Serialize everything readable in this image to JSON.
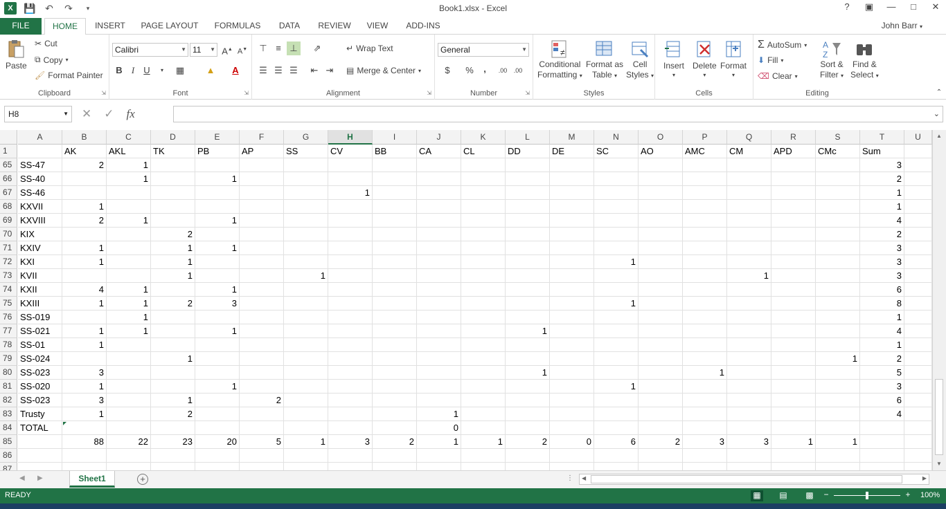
{
  "window": {
    "title": "Book1.xlsx - Excel",
    "user": "John Barr",
    "help": "?",
    "controls": [
      "—",
      "□",
      "✕"
    ]
  },
  "tabs": [
    "FILE",
    "HOME",
    "INSERT",
    "PAGE LAYOUT",
    "FORMULAS",
    "DATA",
    "REVIEW",
    "VIEW",
    "ADD-INS"
  ],
  "ribbon": {
    "clipboard": {
      "label": "Clipboard",
      "paste": "Paste",
      "cut": "Cut",
      "copy": "Copy",
      "format_painter": "Format Painter"
    },
    "font": {
      "label": "Font",
      "name": "Calibri",
      "size": "11",
      "bold": "B",
      "italic": "I",
      "underline": "U",
      "grow": "A",
      "shrink": "A"
    },
    "alignment": {
      "label": "Alignment",
      "wrap": "Wrap Text",
      "merge": "Merge & Center"
    },
    "number": {
      "label": "Number",
      "format": "General",
      "currency": "$",
      "percent": "%",
      "comma": ",",
      "inc_dec": ".00"
    },
    "styles": {
      "label": "Styles",
      "conditional": "Conditional",
      "conditional2": "Formatting",
      "format_as": "Format as",
      "format_as2": "Table",
      "cell": "Cell",
      "cell2": "Styles"
    },
    "cells": {
      "label": "Cells",
      "insert": "Insert",
      "delete": "Delete",
      "format": "Format"
    },
    "editing": {
      "label": "Editing",
      "autosum": "AutoSum",
      "fill": "Fill",
      "clear": "Clear",
      "sort": "Sort &",
      "sort2": "Filter",
      "find": "Find &",
      "find2": "Select"
    }
  },
  "formula_bar": {
    "name_box": "H8",
    "fx": "fx",
    "value": ""
  },
  "sheet": {
    "columns": [
      "A",
      "B",
      "C",
      "D",
      "E",
      "F",
      "G",
      "H",
      "I",
      "J",
      "K",
      "L",
      "M",
      "N",
      "O",
      "P",
      "Q",
      "R",
      "S",
      "T",
      "U"
    ],
    "selected_column": "H",
    "rows": [
      {
        "n": "1",
        "cells": [
          "",
          "AK",
          "AKL",
          "TK",
          "PB",
          "AP",
          "SS",
          "CV",
          "BB",
          "CA",
          "CL",
          "DD",
          "DE",
          "SC",
          "AO",
          "AMC",
          "CM",
          "APD",
          "CMc",
          "Sum",
          ""
        ]
      },
      {
        "n": "65",
        "cells": [
          "SS-47",
          "2",
          "1",
          "",
          "",
          "",
          "",
          "",
          "",
          "",
          "",
          "",
          "",
          "",
          "",
          "",
          "",
          "",
          "",
          "3",
          ""
        ]
      },
      {
        "n": "66",
        "cells": [
          "SS-40",
          "",
          "1",
          "",
          "1",
          "",
          "",
          "",
          "",
          "",
          "",
          "",
          "",
          "",
          "",
          "",
          "",
          "",
          "",
          "2",
          ""
        ]
      },
      {
        "n": "67",
        "cells": [
          "SS-46",
          "",
          "",
          "",
          "",
          "",
          "",
          "1",
          "",
          "",
          "",
          "",
          "",
          "",
          "",
          "",
          "",
          "",
          "",
          "1",
          ""
        ]
      },
      {
        "n": "68",
        "cells": [
          "KXVII",
          "1",
          "",
          "",
          "",
          "",
          "",
          "",
          "",
          "",
          "",
          "",
          "",
          "",
          "",
          "",
          "",
          "",
          "",
          "1",
          ""
        ]
      },
      {
        "n": "69",
        "cells": [
          "KXVIII",
          "2",
          "1",
          "",
          "1",
          "",
          "",
          "",
          "",
          "",
          "",
          "",
          "",
          "",
          "",
          "",
          "",
          "",
          "",
          "4",
          ""
        ]
      },
      {
        "n": "70",
        "cells": [
          "KIX",
          "",
          "",
          "2",
          "",
          "",
          "",
          "",
          "",
          "",
          "",
          "",
          "",
          "",
          "",
          "",
          "",
          "",
          "",
          "2",
          ""
        ]
      },
      {
        "n": "71",
        "cells": [
          "KXIV",
          "1",
          "",
          "1",
          "1",
          "",
          "",
          "",
          "",
          "",
          "",
          "",
          "",
          "",
          "",
          "",
          "",
          "",
          "",
          "3",
          ""
        ]
      },
      {
        "n": "72",
        "cells": [
          "KXI",
          "1",
          "",
          "1",
          "",
          "",
          "",
          "",
          "",
          "",
          "",
          "",
          "",
          "1",
          "",
          "",
          "",
          "",
          "",
          "3",
          ""
        ]
      },
      {
        "n": "73",
        "cells": [
          "KVII",
          "",
          "",
          "1",
          "",
          "",
          "1",
          "",
          "",
          "",
          "",
          "",
          "",
          "",
          "",
          "",
          "1",
          "",
          "",
          "3",
          ""
        ]
      },
      {
        "n": "74",
        "cells": [
          "KXII",
          "4",
          "1",
          "",
          "1",
          "",
          "",
          "",
          "",
          "",
          "",
          "",
          "",
          "",
          "",
          "",
          "",
          "",
          "",
          "6",
          ""
        ]
      },
      {
        "n": "75",
        "cells": [
          "KXIII",
          "1",
          "1",
          "2",
          "3",
          "",
          "",
          "",
          "",
          "",
          "",
          "",
          "",
          "1",
          "",
          "",
          "",
          "",
          "",
          "8",
          ""
        ]
      },
      {
        "n": "76",
        "cells": [
          "SS-019",
          "",
          "1",
          "",
          "",
          "",
          "",
          "",
          "",
          "",
          "",
          "",
          "",
          "",
          "",
          "",
          "",
          "",
          "",
          "1",
          ""
        ]
      },
      {
        "n": "77",
        "cells": [
          "SS-021",
          "1",
          "1",
          "",
          "1",
          "",
          "",
          "",
          "",
          "",
          "",
          "1",
          "",
          "",
          "",
          "",
          "",
          "",
          "",
          "4",
          ""
        ]
      },
      {
        "n": "78",
        "cells": [
          "SS-01",
          "1",
          "",
          "",
          "",
          "",
          "",
          "",
          "",
          "",
          "",
          "",
          "",
          "",
          "",
          "",
          "",
          "",
          "",
          "1",
          ""
        ]
      },
      {
        "n": "79",
        "cells": [
          "SS-024",
          "",
          "",
          "1",
          "",
          "",
          "",
          "",
          "",
          "",
          "",
          "",
          "",
          "",
          "",
          "",
          "",
          "",
          "1",
          "2",
          ""
        ]
      },
      {
        "n": "80",
        "cells": [
          "SS-023",
          "3",
          "",
          "",
          "",
          "",
          "",
          "",
          "",
          "",
          "",
          "1",
          "",
          "",
          "",
          "1",
          "",
          "",
          "",
          "5",
          ""
        ]
      },
      {
        "n": "81",
        "cells": [
          "SS-020",
          "1",
          "",
          "",
          "1",
          "",
          "",
          "",
          "",
          "",
          "",
          "",
          "",
          "1",
          "",
          "",
          "",
          "",
          "",
          "3",
          ""
        ]
      },
      {
        "n": "82",
        "cells": [
          "SS-023",
          "3",
          "",
          "1",
          "",
          "2",
          "",
          "",
          "",
          "",
          "",
          "",
          "",
          "",
          "",
          "",
          "",
          "",
          "",
          "6",
          ""
        ]
      },
      {
        "n": "83",
        "cells": [
          "Trusty",
          "1",
          "",
          "2",
          "",
          "",
          "",
          "",
          "",
          "1",
          "",
          "",
          "",
          "",
          "",
          "",
          "",
          "",
          "",
          "4",
          ""
        ]
      },
      {
        "n": "84",
        "cells": [
          "TOTAL",
          "",
          "",
          "",
          "",
          "",
          "",
          "",
          "",
          "0",
          "",
          "",
          "",
          "",
          "",
          "",
          "",
          "",
          "",
          "",
          ""
        ]
      },
      {
        "n": "85",
        "cells": [
          "",
          "88",
          "22",
          "23",
          "20",
          "5",
          "1",
          "3",
          "2",
          "1",
          "1",
          "2",
          "0",
          "6",
          "2",
          "3",
          "3",
          "1",
          "1",
          "",
          ""
        ]
      },
      {
        "n": "86",
        "cells": [
          "",
          "",
          "",
          "",
          "",
          "",
          "",
          "",
          "",
          "",
          "",
          "",
          "",
          "",
          "",
          "",
          "",
          "",
          "",
          "",
          ""
        ]
      },
      {
        "n": "87",
        "cells": [
          "",
          "",
          "",
          "",
          "",
          "",
          "",
          "",
          "",
          "",
          "",
          "",
          "",
          "",
          "",
          "",
          "",
          "",
          "",
          "",
          ""
        ]
      }
    ]
  },
  "sheet_tabs": {
    "active": "Sheet1",
    "add": "+"
  },
  "status": {
    "ready": "READY",
    "zoom": "100%"
  },
  "colors": {
    "accent": "#217346"
  }
}
